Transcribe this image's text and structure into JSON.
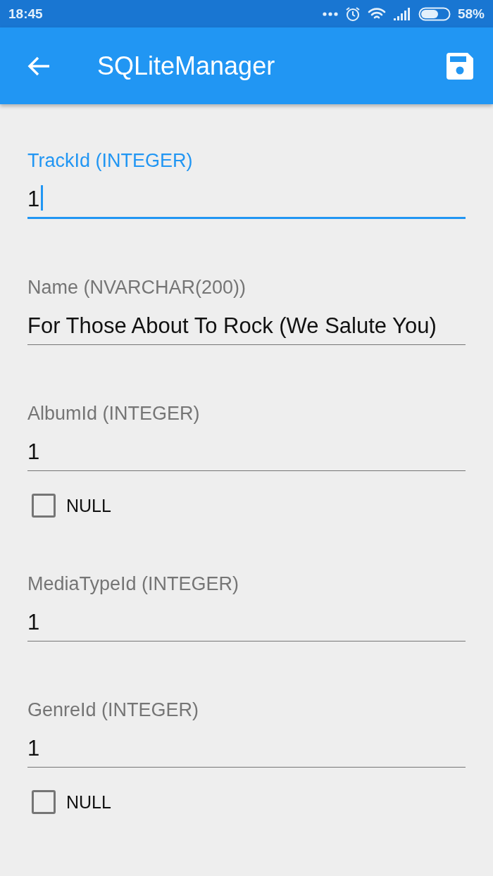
{
  "status_bar": {
    "time": "18:45",
    "battery": "58%"
  },
  "app_bar": {
    "title": "SQLiteManager"
  },
  "fields": [
    {
      "label": "TrackId (INTEGER)",
      "value": "1",
      "focused": true
    },
    {
      "label": "Name (NVARCHAR(200))",
      "value": "For Those About To Rock (We Salute You)",
      "focused": false
    },
    {
      "label": "AlbumId (INTEGER)",
      "value": "1",
      "focused": false,
      "null_option": {
        "label": "NULL",
        "checked": false
      }
    },
    {
      "label": "MediaTypeId (INTEGER)",
      "value": "1",
      "focused": false
    },
    {
      "label": "GenreId (INTEGER)",
      "value": "1",
      "focused": false,
      "null_option": {
        "label": "NULL",
        "checked": false
      }
    }
  ]
}
